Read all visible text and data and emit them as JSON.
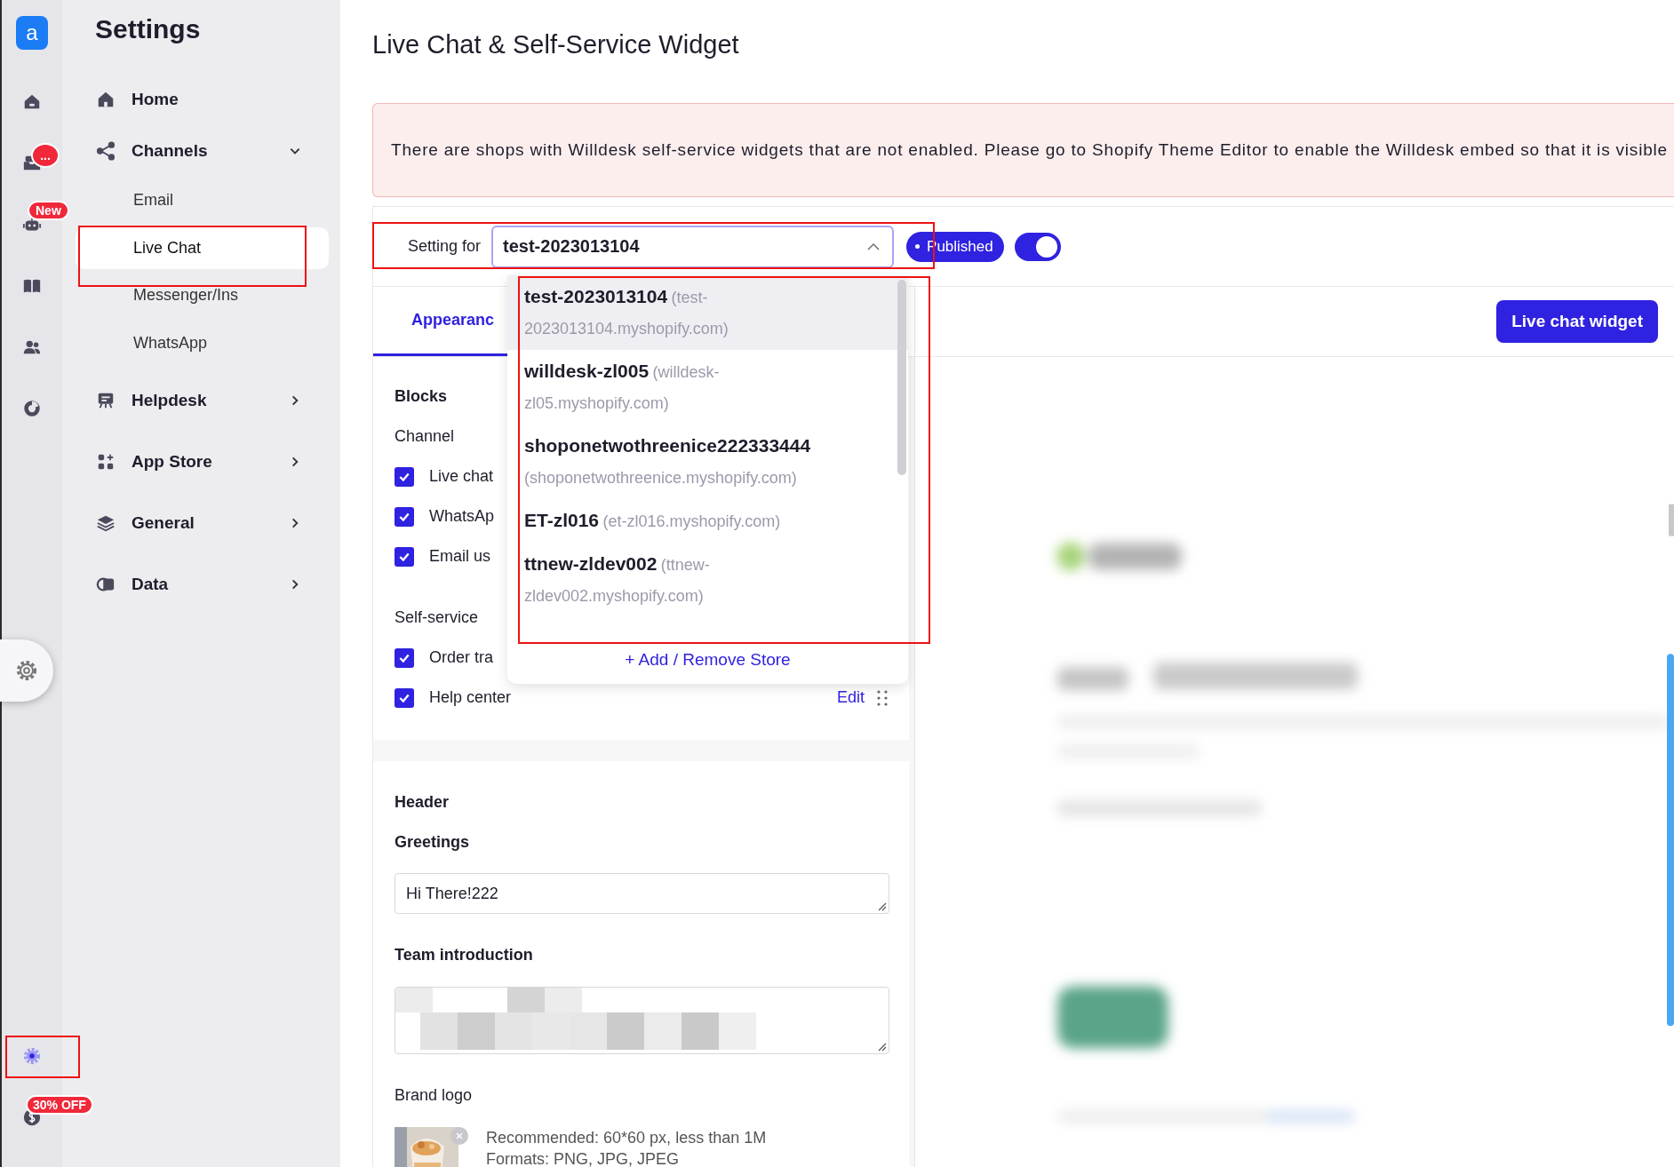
{
  "rail": {
    "logo": "a",
    "items": [
      {
        "kind": "home",
        "selected": false
      },
      {
        "kind": "inbox",
        "selected": false,
        "badge": "..."
      },
      {
        "kind": "bot",
        "selected": false,
        "badge": "New"
      },
      {
        "kind": "book",
        "selected": false
      },
      {
        "kind": "team",
        "selected": false
      },
      {
        "kind": "chart",
        "selected": false
      }
    ],
    "bottom": [
      {
        "kind": "settings",
        "selected": true
      },
      {
        "kind": "billing",
        "selected": false,
        "badge": "30% OFF"
      }
    ]
  },
  "sidebar": {
    "title": "Settings",
    "items": [
      {
        "kind": "home",
        "label": "Home"
      },
      {
        "kind": "share",
        "label": "Channels",
        "expanded": true,
        "children": [
          {
            "label": "Email",
            "selected": false
          },
          {
            "label": "Live Chat",
            "selected": true
          },
          {
            "label": "Messenger/Ins",
            "selected": false
          },
          {
            "label": "WhatsApp",
            "selected": false
          }
        ]
      },
      {
        "kind": "helpdesk",
        "label": "Helpdesk",
        "expanded": false
      },
      {
        "kind": "apps",
        "label": "App Store",
        "expanded": false
      },
      {
        "kind": "layers",
        "label": "General",
        "expanded": false
      },
      {
        "kind": "data",
        "label": "Data",
        "expanded": false
      }
    ]
  },
  "page": {
    "title": "Live Chat & Self-Service Widget",
    "alert": "There are shops with Willdesk self-service widgets that are not enabled. Please go to Shopify Theme Editor to enable the Willdesk embed so that it is visible"
  },
  "setting": {
    "label": "Setting for",
    "store": "test-2023013104",
    "status": "Published",
    "enabled": true
  },
  "dropdown": {
    "stores": [
      {
        "name": "test-2023013104",
        "domain": "(test-2023013104.myshopify.com)",
        "selected": true
      },
      {
        "name": "willdesk-zl005",
        "domain": "(willdesk-zl05.myshopify.com)",
        "selected": false
      },
      {
        "name": "shoponetwothreenice222333444",
        "domain": "(shoponetwothreenice.myshopify.com)",
        "selected": false
      },
      {
        "name": "ET-zl016",
        "domain": "(et-zl016.myshopify.com)",
        "selected": false
      },
      {
        "name": "ttnew-zldev002",
        "domain": "(ttnew-zldev002.myshopify.com)",
        "selected": false
      }
    ],
    "action": "+ Add / Remove Store"
  },
  "tabs": [
    {
      "label": "Appearanc",
      "selected": true
    }
  ],
  "preview_tabs": [
    {
      "label": "Live chat widget",
      "selected": true
    }
  ],
  "blocks": {
    "title": "Blocks",
    "groups": [
      {
        "title": "Channel",
        "items": [
          {
            "label": "Live chat",
            "checked": true
          },
          {
            "label": "WhatsAp",
            "checked": true
          },
          {
            "label": "Email us",
            "checked": true
          }
        ]
      },
      {
        "title": "Self-service",
        "items": [
          {
            "label": "Order tra",
            "checked": true
          },
          {
            "label": "Help center",
            "checked": true,
            "action": "Edit"
          }
        ]
      }
    ]
  },
  "header": {
    "title": "Header",
    "greetings_label": "Greetings",
    "greetings": "Hi There!222",
    "team_label": "Team introduction",
    "logo_label": "Brand logo",
    "logo_hint": "Recommended: 60*60 px, less than 1M",
    "logo_formats": "Formats: PNG, JPG, JPEG"
  }
}
